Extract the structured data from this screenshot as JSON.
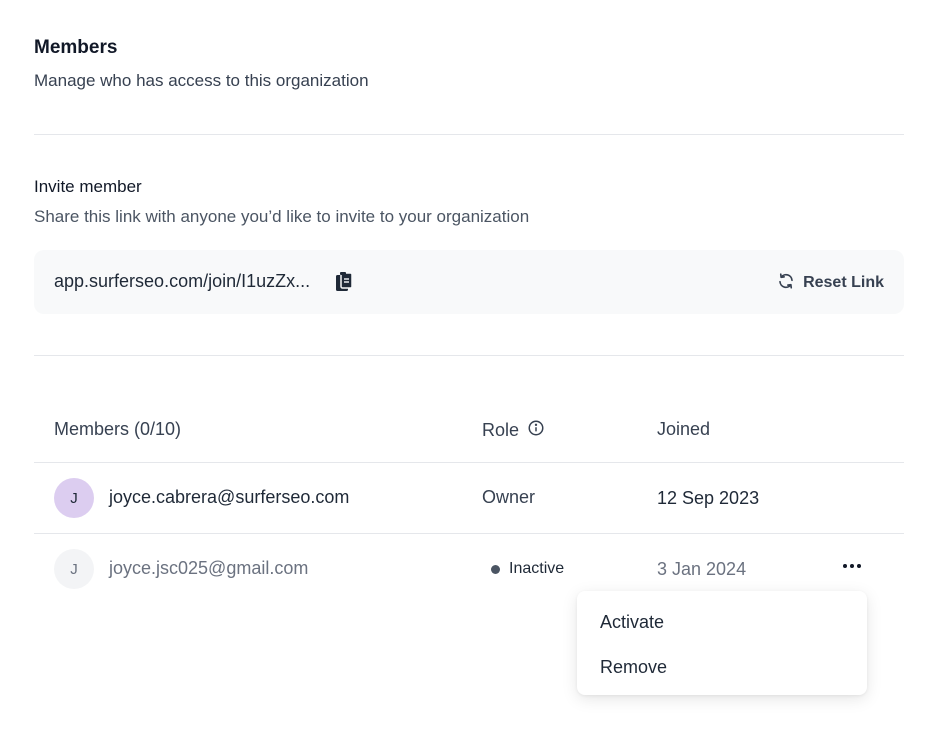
{
  "members_section": {
    "title": "Members",
    "subtitle": "Manage who has access to this organization"
  },
  "invite": {
    "title": "Invite member",
    "subtitle": "Share this link with anyone you’d like to invite to your organization",
    "link": "app.surferseo.com/join/I1uzZx...",
    "copy_icon": "clipboard-copy-icon",
    "reset_label": "Reset Link",
    "reset_icon": "refresh-icon"
  },
  "table": {
    "headers": {
      "members": "Members (0/10)",
      "role": "Role",
      "joined": "Joined"
    },
    "rows": [
      {
        "initial": "J",
        "email": "joyce.cabrera@surferseo.com",
        "role": "Owner",
        "joined": "12 Sep 2023"
      },
      {
        "initial": "J",
        "email": "joyce.jsc025@gmail.com",
        "status": "Inactive",
        "joined": "3 Jan 2024"
      }
    ]
  },
  "context_menu": {
    "items": [
      "Activate",
      "Remove"
    ]
  },
  "colors": {
    "avatar_active_bg": "#dccdf0",
    "avatar_inactive_bg": "#f3f4f6",
    "muted_text": "#6b7280",
    "divider": "#e5e7eb"
  }
}
